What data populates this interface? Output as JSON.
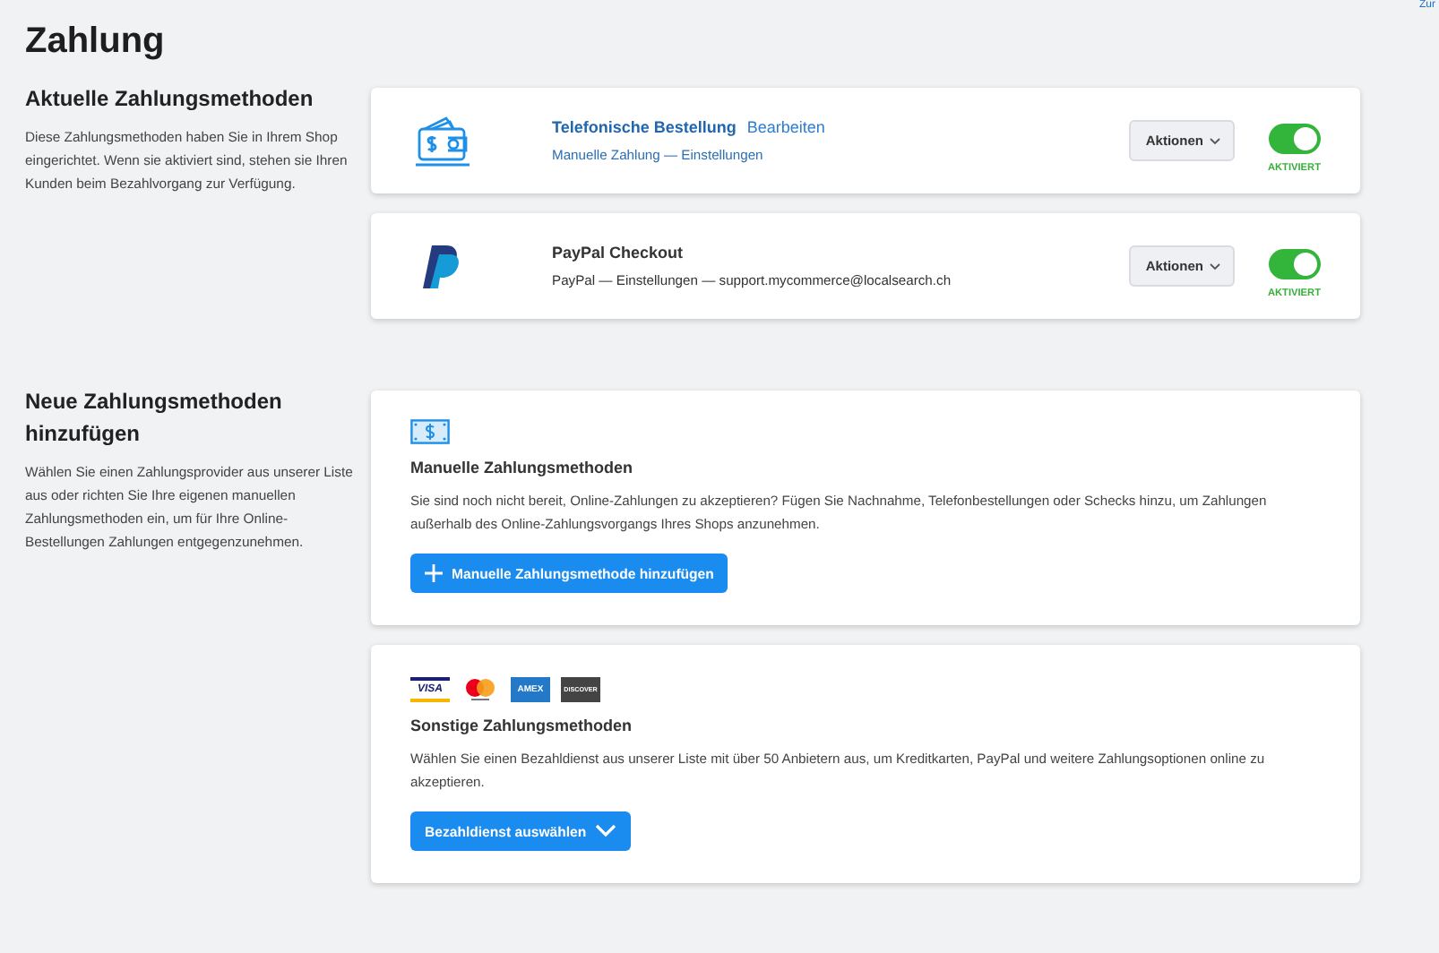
{
  "corner_link": "Zur",
  "title": "Zahlung",
  "sections": [
    {
      "heading": "Aktuelle Zahlungsmethoden",
      "description": "Diese Zahlungsmethoden haben Sie in Ihrem Shop eingerichtet. Wenn sie aktiviert sind, stehen sie Ihren Kunden beim Bezahlvorgang zur Verfügung.",
      "methods": [
        {
          "kind": "wallet",
          "name": "Telefonische Bestellung",
          "name_is_link": true,
          "edit_link": "Bearbeiten",
          "details": "Manuelle Zahlung — Einstellungen",
          "details_is_link": true,
          "actions": "Aktionen",
          "on": true,
          "status": "AKTIVIERT"
        },
        {
          "kind": "paypal",
          "name": "PayPal Checkout",
          "name_is_link": false,
          "details": "PayPal — Einstellungen — support.mycommerce@localsearch.ch",
          "details_is_link": false,
          "actions": "Aktionen",
          "on": true,
          "status": "AKTIVIERT"
        }
      ]
    },
    {
      "heading": "Neue Zahlungsmethoden hinzufügen",
      "description": "Wählen Sie einen Zahlungsprovider aus unserer Liste aus oder richten Sie Ihre eigenen manuellen Zahlungsmethoden ein, um für Ihre Online-Bestellungen Zahlungen entgegenzunehmen.",
      "panels": [
        {
          "kind": "manual",
          "title": "Manuelle Zahlungsmethoden",
          "text": "Sie sind noch nicht bereit, Online-Zahlungen zu akzeptieren? Fügen Sie Nachnahme, Telefonbestellungen oder Schecks hinzu, um Zahlungen außerhalb des Online-Zahlungsvorgangs Ihres Shops anzunehmen.",
          "button": "Manuelle Zahlungsmethode hinzufügen"
        },
        {
          "kind": "providers",
          "cards": [
            {
              "kind": "visa",
              "label": "VISA"
            },
            {
              "kind": "mastercard"
            },
            {
              "kind": "amex",
              "label": "AMEX"
            },
            {
              "kind": "discover",
              "label": "DISCOVER"
            }
          ],
          "title": "Sonstige Zahlungsmethoden",
          "text": "Wählen Sie einen Bezahldienst aus unserer Liste mit über 50 Anbietern aus, um Kreditkarten, PayPal und weitere Zahlungsoptionen online zu akzeptieren.",
          "button": "Bezahldienst auswählen"
        }
      ]
    }
  ]
}
